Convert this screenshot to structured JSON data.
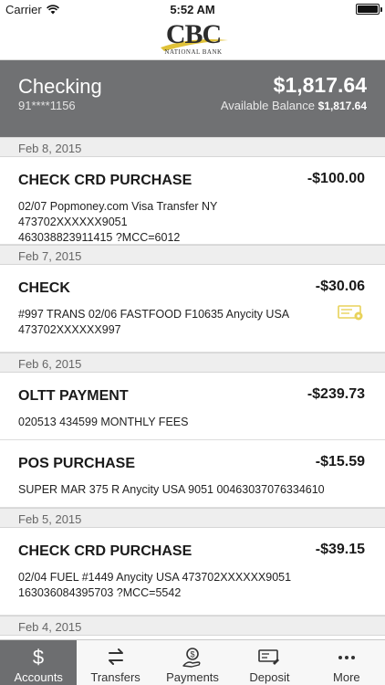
{
  "status_bar": {
    "carrier": "Carrier",
    "time": "5:52 AM",
    "battery_level": 1.0
  },
  "logo": {
    "name": "CBC",
    "subtitle": "NATIONAL BANK"
  },
  "account": {
    "name": "Checking",
    "number": "91****1156",
    "balance": "$1,817.64",
    "available_label": "Available Balance",
    "available_value": "$1,817.64"
  },
  "transactions": [
    {
      "date": "Feb 8, 2015",
      "items": [
        {
          "title": "CHECK CRD PURCHASE",
          "amount": "-$100.00",
          "desc": [
            "02/07 Popmoney.com Visa Transfer NY 473702XXXXXX9051",
            "463038823911415 ?MCC=6012"
          ]
        }
      ]
    },
    {
      "date": "Feb 7, 2015",
      "items": [
        {
          "title": "CHECK",
          "amount": "-$30.06",
          "icon": "check-image-icon",
          "desc": [
            "#997 TRANS 02/06 FASTFOOD F10635 Anycity USA",
            "473702XXXXXX997"
          ]
        }
      ]
    },
    {
      "date": "Feb 6, 2015",
      "items": [
        {
          "title": "OLTT PAYMENT",
          "amount": "-$239.73",
          "desc": [
            "020513 434599 MONTHLY FEES"
          ]
        },
        {
          "title": "POS PURCHASE",
          "amount": "-$15.59",
          "desc": [
            "SUPER MAR 375 R Anycity USA 9051 00463037076334610"
          ]
        }
      ]
    },
    {
      "date": "Feb 5, 2015",
      "items": [
        {
          "title": "CHECK CRD PURCHASE",
          "amount": "-$39.15",
          "desc": [
            "02/04 FUEL #1449 Anycity USA 473702XXXXXX9051",
            "163036084395703 ?MCC=5542"
          ]
        }
      ]
    },
    {
      "date": "Feb 4, 2015",
      "items": []
    }
  ],
  "tabs": [
    {
      "label": "Accounts",
      "icon": "dollar-icon",
      "active": true
    },
    {
      "label": "Transfers",
      "icon": "transfer-icon",
      "active": false
    },
    {
      "label": "Payments",
      "icon": "payments-icon",
      "active": false
    },
    {
      "label": "Deposit",
      "icon": "deposit-icon",
      "active": false
    },
    {
      "label": "More",
      "icon": "more-icon",
      "active": false
    }
  ],
  "colors": {
    "header_gray": "#707173",
    "logo_gold": "#e0c23a",
    "check_icon": "#e8d25a",
    "tab_active": "#6d6e70"
  }
}
